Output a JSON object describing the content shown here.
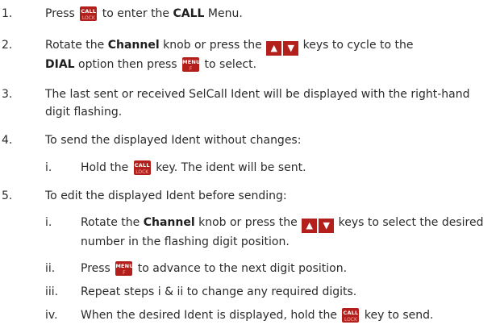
{
  "keys": {
    "call_top": "CALL",
    "call_bottom": "LOCK",
    "menu_top": "MENU",
    "menu_bottom": "F",
    "up": "▲",
    "down": "▼"
  },
  "steps": [
    {
      "num": "1.",
      "a": "Press",
      "b": "to enter the",
      "bold": "CALL",
      "c": "Menu."
    },
    {
      "num": "2.",
      "a": "Rotate the",
      "bold1": "Channel",
      "b": "knob or press the",
      "c": "keys to cycle to the",
      "bold2": "DIAL",
      "d": "option then press",
      "e": "to select."
    },
    {
      "num": "3.",
      "text": "The last sent or received SelCall Ident will be displayed with the right-hand digit flashing."
    },
    {
      "num": "4.",
      "text": "To send the displayed Ident without changes:"
    },
    {
      "num": "i.",
      "a": "Hold the",
      "b": "key. The ident will be sent."
    },
    {
      "num": "5.",
      "text": "To edit the displayed Ident before sending:"
    },
    {
      "num": "i.",
      "a": "Rotate the",
      "bold1": "Channel",
      "b": "knob or press the",
      "c": "keys to select the desired number in the flashing digit position."
    },
    {
      "num": "ii.",
      "a": "Press",
      "b": "to advance to the next digit position."
    },
    {
      "num": "iii.",
      "text": "Repeat steps i & ii to change any required digits."
    },
    {
      "num": "iv.",
      "a": "When the desired Ident is displayed, hold the",
      "b": "key to send."
    }
  ]
}
